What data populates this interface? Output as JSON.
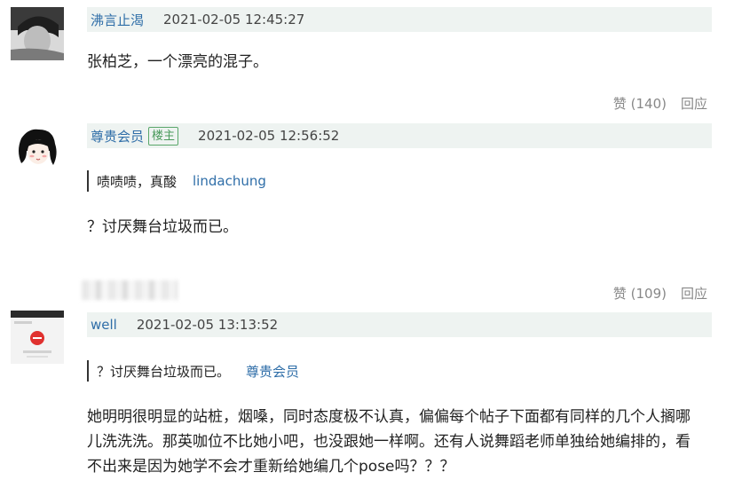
{
  "comments": [
    {
      "username": "沸言止渴",
      "timestamp": "2021-02-05 12:45:27",
      "body": "张柏芝，一个漂亮的混子。",
      "likes_label": "赞 (140)",
      "reply_label": "回应"
    },
    {
      "username": "尊贵会员",
      "badge": "楼主",
      "timestamp": "2021-02-05 12:56:52",
      "quote_text": "啧啧啧，真酸",
      "quote_user": "lindachung",
      "body": "？讨厌舞台垃圾而已。",
      "likes_label": "赞 (109)",
      "reply_label": "回应"
    },
    {
      "username": "well",
      "timestamp": "2021-02-05 13:13:52",
      "quote_text": "？讨厌舞台垃圾而已。",
      "quote_user": "尊贵会员",
      "body_lines": [
        "她明明很明显的站桩，烟嗓，同时态度极不认真，偏偏每个帖子下面都有同样的几个人搁哪",
        "儿洗洗洗。那英咖位不比她小吧，也没跟她一样啊。还有人说舞蹈老师单独给她编排的，看",
        "不出来是因为她学不会才重新给她编几个pose吗？？？"
      ]
    }
  ]
}
